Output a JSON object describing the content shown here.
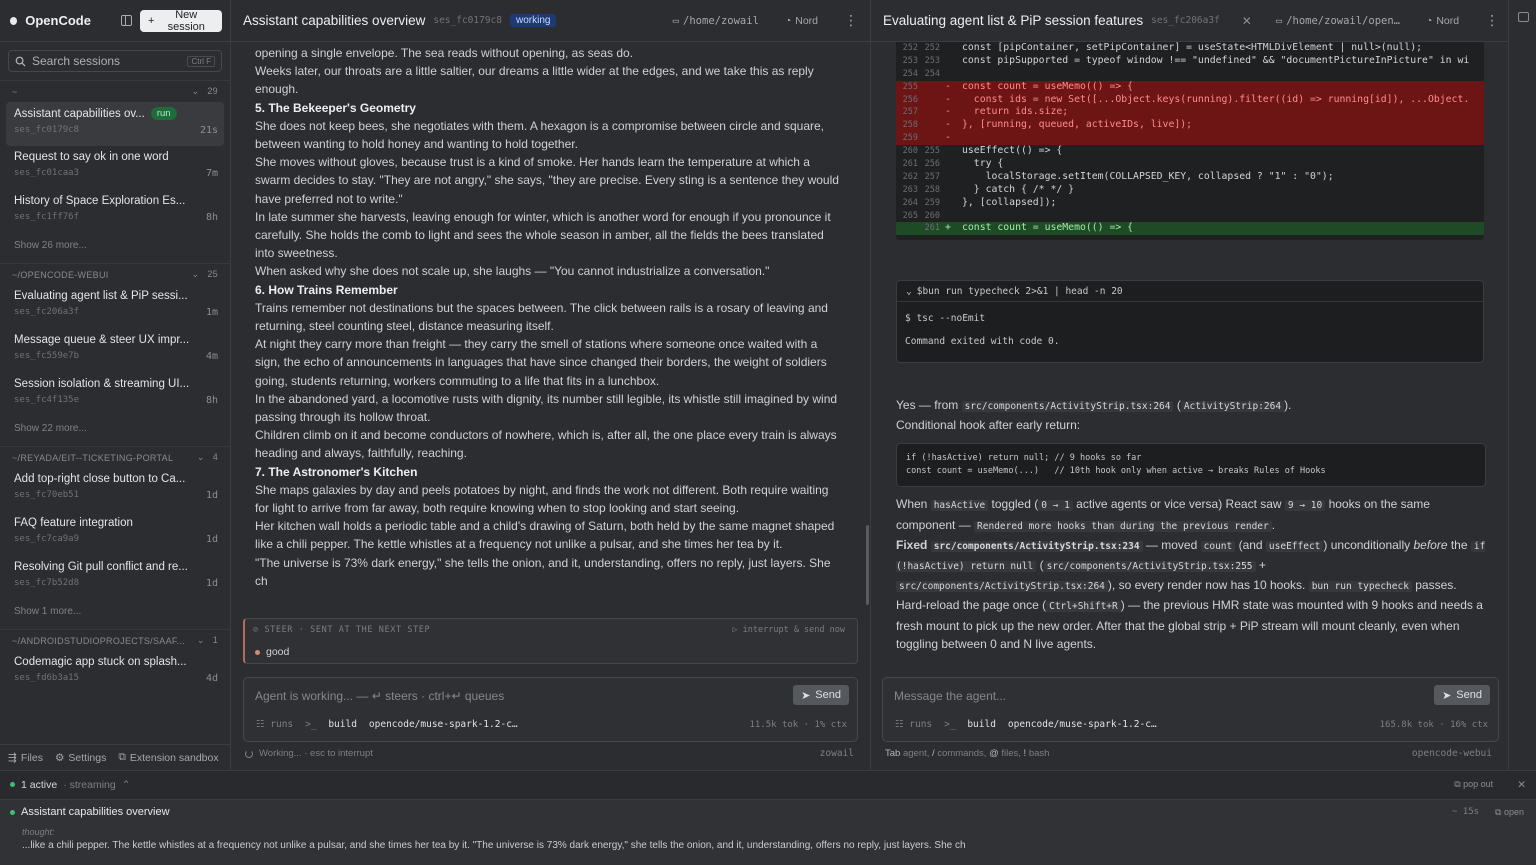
{
  "sidebar": {
    "brand": "OpenCode",
    "new_session": "New session",
    "search_placeholder": "Search sessions",
    "search_kbd": "Ctrl F",
    "groups": [
      {
        "label": "~",
        "count": "29",
        "sessions": [
          {
            "title": "Assistant capabilities ov...",
            "id": "ses_fc0179c8",
            "age": "21s",
            "badge": "run"
          },
          {
            "title": "Request to say ok in one word",
            "id": "ses_fc01caa3",
            "age": "7m"
          },
          {
            "title": "History of Space Exploration Es...",
            "id": "ses_fc1ff76f",
            "age": "8h"
          }
        ],
        "more": "Show 26 more..."
      },
      {
        "label": "~/OPENCODE-WEBUI",
        "count": "25",
        "sessions": [
          {
            "title": "Evaluating agent list & PiP sessi...",
            "id": "ses_fc206a3f",
            "age": "1m"
          },
          {
            "title": "Message queue & steer UX impr...",
            "id": "ses_fc559e7b",
            "age": "4m"
          },
          {
            "title": "Session isolation & streaming UI...",
            "id": "ses_fc4f135e",
            "age": "8h"
          }
        ],
        "more": "Show 22 more..."
      },
      {
        "label": "~/REYADA/EIT--TICKETING-PORTAL",
        "count": "4",
        "sessions": [
          {
            "title": "Add top-right close button to Ca...",
            "id": "ses_fc70eb51",
            "age": "1d"
          },
          {
            "title": "FAQ feature integration",
            "id": "ses_fc7ca9a9",
            "age": "1d"
          },
          {
            "title": "Resolving Git pull conflict and re...",
            "id": "ses_fc7b52d8",
            "age": "1d"
          }
        ],
        "more": "Show 1 more..."
      },
      {
        "label": "~/ANDROIDSTUDIOPROJECTS/SAAF...",
        "count": "1",
        "sessions": [
          {
            "title": "Codemagic app stuck on splash...",
            "id": "ses_fd6b3a15",
            "age": "4d"
          }
        ]
      }
    ],
    "footer": {
      "files": "Files",
      "settings": "Settings",
      "extension": "Extension sandbox"
    }
  },
  "pane1": {
    "title": "Assistant capabilities overview",
    "id": "ses_fc0179c8",
    "badge": "working",
    "path": "/home/zowail",
    "theme": "Nord",
    "content": [
      {
        "type": "p",
        "text": "opening a single envelope. The sea reads without opening, as seas do."
      },
      {
        "type": "p",
        "text": "Weeks later, our throats are a little saltier, our dreams a little wider at the edges, and we take this as reply enough."
      },
      {
        "type": "h",
        "text": "5. The Bekeeper's Geometry"
      },
      {
        "type": "p",
        "text": "She does not keep bees, she negotiates with them. A hexagon is a compromise between circle and square, between wanting to hold honey and wanting to hold together."
      },
      {
        "type": "p",
        "text": "She moves without gloves, because trust is a kind of smoke. Her hands learn the temperature at which a swarm decides to stay. \"They are not angry,\" she says, \"they are precise. Every sting is a sentence they would have preferred not to write.\""
      },
      {
        "type": "p",
        "text": "In late summer she harvests, leaving enough for winter, which is another word for enough if you pronounce it carefully. She holds the comb to light and sees the whole season in amber, all the fields the bees translated into sweetness."
      },
      {
        "type": "p",
        "text": "When asked why she does not scale up, she laughs — \"You cannot industrialize a conversation.\""
      },
      {
        "type": "h",
        "text": "6. How Trains Remember"
      },
      {
        "type": "p",
        "text": "Trains remember not destinations but the spaces between. The click between rails is a rosary of leaving and returning, steel counting steel, distance measuring itself."
      },
      {
        "type": "p",
        "text": "At night they carry more than freight — they carry the smell of stations where someone once waited with a sign, the echo of announcements in languages that have since changed their borders, the weight of soldiers going, students returning, workers commuting to a life that fits in a lunchbox."
      },
      {
        "type": "p",
        "text": "In the abandoned yard, a locomotive rusts with dignity, its number still legible, its whistle still imagined by wind passing through its hollow throat."
      },
      {
        "type": "p",
        "text": "Children climb on it and become conductors of nowhere, which is, after all, the one place every train is always heading and always, faithfully, reaching."
      },
      {
        "type": "h",
        "text": "7. The Astronomer's Kitchen"
      },
      {
        "type": "p",
        "text": "She maps galaxies by day and peels potatoes by night, and finds the work not different. Both require waiting for light to arrive from far away, both require knowing when to stop looking and start seeing."
      },
      {
        "type": "p",
        "text": "Her kitchen wall holds a periodic table and a child's drawing of Saturn, both held by the same magnet shaped like a chili pepper. The kettle whistles at a frequency not unlike a pulsar, and she times her tea by it."
      },
      {
        "type": "p",
        "text": "\"The universe is 73% dark energy,\" she tells the onion, and it, understanding, offers no reply, just layers. She ch"
      }
    ],
    "steer": {
      "label": "STEER · SENT AT THE NEXT STEP",
      "interrupt": "interrupt & send now",
      "item": "good"
    },
    "composer": {
      "placeholder": "Agent is working... — ↵ steers · ctrl+↵ queues",
      "send": "Send",
      "runs": "runs",
      "mode": "build",
      "model": "opencode/muse-spark-1.2-c…",
      "tokens": "11.5k tok · 1% ctx"
    },
    "status": {
      "left": "Working... · esc to interrupt",
      "right": "zowail"
    }
  },
  "pane2": {
    "title": "Evaluating agent list & PiP session features",
    "id": "ses_fc206a3f",
    "path": "/home/zowail/open…",
    "theme": "Nord",
    "diff": [
      {
        "a": "252",
        "b": "252",
        "s": "",
        "t": "const [pipContainer, setPipContainer] = useState<HTMLDivElement | null>(null);",
        "k": "ctx"
      },
      {
        "a": "253",
        "b": "253",
        "s": "",
        "t": "const pipSupported = typeof window !== \"undefined\" && \"documentPictureInPicture\" in wi",
        "k": "ctx"
      },
      {
        "a": "254",
        "b": "254",
        "s": "",
        "t": "",
        "k": "ctx"
      },
      {
        "a": "255",
        "b": "",
        "s": "-",
        "t": "const count = useMemo(() => {",
        "k": "del"
      },
      {
        "a": "256",
        "b": "",
        "s": "-",
        "t": "  const ids = new Set([...Object.keys(running).filter((id) => running[id]), ...Object.",
        "k": "del"
      },
      {
        "a": "257",
        "b": "",
        "s": "-",
        "t": "  return ids.size;",
        "k": "del"
      },
      {
        "a": "258",
        "b": "",
        "s": "-",
        "t": "}, [running, queued, activeIDs, live]);",
        "k": "del"
      },
      {
        "a": "259",
        "b": "",
        "s": "-",
        "t": "",
        "k": "del"
      },
      {
        "a": "260",
        "b": "255",
        "s": "",
        "t": "useEffect(() => {",
        "k": "ctx"
      },
      {
        "a": "261",
        "b": "256",
        "s": "",
        "t": "  try {",
        "k": "ctx"
      },
      {
        "a": "262",
        "b": "257",
        "s": "",
        "t": "    localStorage.setItem(COLLAPSED_KEY, collapsed ? \"1\" : \"0\");",
        "k": "ctx"
      },
      {
        "a": "263",
        "b": "258",
        "s": "",
        "t": "  } catch { /* */ }",
        "k": "ctx"
      },
      {
        "a": "264",
        "b": "259",
        "s": "",
        "t": "}, [collapsed]);",
        "k": "ctx"
      },
      {
        "a": "265",
        "b": "260",
        "s": "",
        "t": "",
        "k": "ctx"
      },
      {
        "a": "",
        "b": "261",
        "s": "+",
        "t": "const count = useMemo(() => {",
        "k": "add"
      }
    ],
    "terminal": {
      "cmd": "$bun run typecheck 2>&1 | head -n 20",
      "line1": "$ tsc --noEmit",
      "line2": "Command exited with code 0."
    },
    "prose": {
      "p1a": "Yes — from ",
      "p1code1": "src/components/ActivityStrip.tsx:264",
      "p1b": " (",
      "p1code2": "ActivityStrip:264",
      "p1c": ").",
      "p1d": "Conditional hook after early return:",
      "code": "if (!hasActive) return null; // 9 hooks so far\nconst count = useMemo(...)   // 10th hook only when active → breaks Rules of Hooks",
      "p2a": "When ",
      "p2code1": "hasActive",
      "p2b": " toggled (",
      "p2code2": "0 → 1",
      "p2c": " active agents or vice versa) React saw ",
      "p2code3": "9 → 10",
      "p2d": " hooks on the same component — ",
      "p2code4": "Rendered more hooks than during the previous render",
      "p2e": ".",
      "p3a": "Fixed ",
      "p3code1": "src/components/ActivityStrip.tsx:234",
      "p3b": " — moved ",
      "p3code2": "count",
      "p3c": " (and ",
      "p3code3": "useEffect",
      "p3d": ") unconditionally ",
      "p3e": "before",
      "p3f": " the ",
      "p3code4": "if (!hasActive) return null",
      "p3g": " (",
      "p3code5": "src/components/ActivityStrip.tsx:255",
      "p3h": " + ",
      "p3code6": "src/components/ActivityStrip.tsx:264",
      "p3i": "), so every render now has 10 hooks. ",
      "p3code7": "bun run typecheck",
      "p3j": " passes.",
      "p4a": "Hard-reload the page once (",
      "p4code1": "Ctrl+Shift+R",
      "p4b": ") — the previous HMR state was mounted with 9 hooks and needs a fresh mount to pick up the new order. After that the global strip + PiP stream will mount cleanly, even when toggling between 0 and N live agents."
    },
    "composer": {
      "placeholder": "Message the agent...",
      "send": "Send",
      "runs": "runs",
      "mode": "build",
      "model": "opencode/muse-spark-1.2-c…",
      "tokens": "165.8k tok · 16% ctx"
    },
    "status": {
      "tab": "Tab",
      "agent": "agent,",
      "slash": "/",
      "commands": "commands,",
      "at": "@",
      "files": "files,",
      "bang": "!",
      "bash": "bash",
      "right": "opencode-webui"
    }
  },
  "strip": {
    "active": "1 active",
    "streaming": "· streaming",
    "popout": "pop out",
    "card_title": "Assistant capabilities overview",
    "time": "~ 15s",
    "open": "open",
    "thought_label": "thought:",
    "thought": "...like a chili pepper. The kettle whistles at a frequency not unlike a pulsar, and she times her tea by it. \"The universe is 73% dark energy,\" she tells the onion, and it, understanding, offers no reply, just layers. She ch"
  }
}
